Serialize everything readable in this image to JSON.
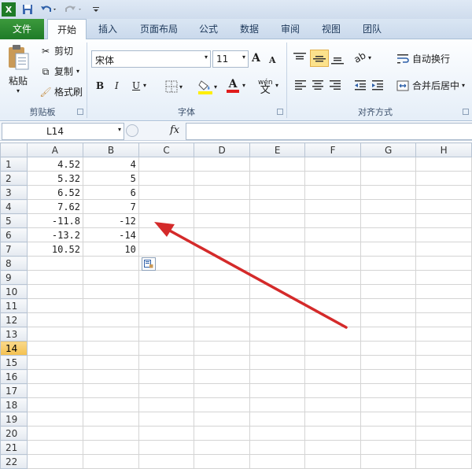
{
  "qat": {
    "excel_icon": "excel-logo-icon",
    "save_icon": "save-icon",
    "undo_icon": "undo-icon",
    "redo_icon": "redo-icon",
    "customize_icon": "customize-icon"
  },
  "tabs": [
    {
      "label": "文件"
    },
    {
      "label": "开始"
    },
    {
      "label": "插入"
    },
    {
      "label": "页面布局"
    },
    {
      "label": "公式"
    },
    {
      "label": "数据"
    },
    {
      "label": "审阅"
    },
    {
      "label": "视图"
    },
    {
      "label": "团队"
    }
  ],
  "clipboard": {
    "paste": "粘贴",
    "cut": "剪切",
    "copy": "复制",
    "format_painter": "格式刷",
    "group_label": "剪贴板"
  },
  "font": {
    "name": "宋体",
    "size": "11",
    "bold": "B",
    "italic": "I",
    "underline": "U",
    "grow": "A",
    "shrink": "A",
    "phonetic": "wén",
    "group_label": "字体",
    "accent_fill": "#ffee00",
    "accent_font": "#e01c1c"
  },
  "alignment": {
    "wrap_text": "自动换行",
    "merge_center": "合并后居中",
    "group_label": "对齐方式"
  },
  "formula_bar": {
    "name_box": "L14",
    "fx": "fx",
    "value": ""
  },
  "sheet": {
    "columns": [
      "A",
      "B",
      "C",
      "D",
      "E",
      "F",
      "G",
      "H"
    ],
    "selected_row": "14",
    "rows": [
      {
        "num": "1",
        "a": "4.52",
        "b": "4"
      },
      {
        "num": "2",
        "a": "5.32",
        "b": "5"
      },
      {
        "num": "3",
        "a": "6.52",
        "b": "6"
      },
      {
        "num": "4",
        "a": "7.62",
        "b": "7"
      },
      {
        "num": "5",
        "a": "-11.8",
        "b": "-12"
      },
      {
        "num": "6",
        "a": "-13.2",
        "b": "-14"
      },
      {
        "num": "7",
        "a": "10.52",
        "b": "10"
      },
      {
        "num": "8",
        "a": "",
        "b": ""
      },
      {
        "num": "9",
        "a": "",
        "b": ""
      },
      {
        "num": "10",
        "a": "",
        "b": ""
      },
      {
        "num": "11",
        "a": "",
        "b": ""
      },
      {
        "num": "12",
        "a": "",
        "b": ""
      },
      {
        "num": "13",
        "a": "",
        "b": ""
      },
      {
        "num": "14",
        "a": "",
        "b": ""
      },
      {
        "num": "15",
        "a": "",
        "b": ""
      },
      {
        "num": "16",
        "a": "",
        "b": ""
      },
      {
        "num": "17",
        "a": "",
        "b": ""
      },
      {
        "num": "18",
        "a": "",
        "b": ""
      },
      {
        "num": "19",
        "a": "",
        "b": ""
      },
      {
        "num": "20",
        "a": "",
        "b": ""
      },
      {
        "num": "21",
        "a": "",
        "b": ""
      },
      {
        "num": "22",
        "a": "",
        "b": ""
      }
    ]
  },
  "annotation": {
    "arrow_color": "#d42a2a",
    "paste_options_icon": "paste-options-icon"
  }
}
